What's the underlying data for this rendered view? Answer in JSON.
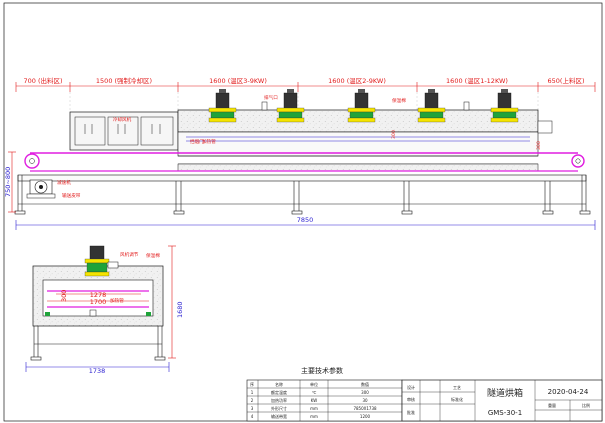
{
  "top_view": {
    "zones": [
      {
        "text": "700 (出料区)"
      },
      {
        "text": "1500 (强制冷却区)"
      },
      {
        "text": "1600 (温区3-9KW)"
      },
      {
        "text": "1600 (温区2-9KW)"
      },
      {
        "text": "1600 (温区1-12KW)"
      },
      {
        "text": "650(上料区)"
      }
    ],
    "height_label": "750~800",
    "total_length": "7850",
    "inner_height_a": "300",
    "inner_height_b": "300",
    "annotations": {
      "cooling_fan": "冷却风机",
      "exhaust_a": "排气口",
      "exhaust_b": "排气口",
      "insulation": "保温棉",
      "vent_gate": "挡烟门",
      "heating_tube": "加热管",
      "motor": "减速机",
      "belt": "输送皮带"
    }
  },
  "section_view": {
    "width_1278": "1278",
    "width_1700": "1700",
    "height_300": "300",
    "total_height": "1680",
    "total_width": "1738",
    "annotations": {
      "fan_guard": "风机调节",
      "cover": "保温棉",
      "heating_tube": "加热管"
    }
  },
  "tech_table": {
    "title": "主要技术参数",
    "header": {
      "c1": "序",
      "c2": "名称",
      "c3": "单位",
      "c4": "数值"
    },
    "rows": [
      {
        "n": "1",
        "name": "额定温度",
        "unit": "℃",
        "value": "300"
      },
      {
        "n": "2",
        "name": "加热功率",
        "unit": "KW",
        "value": "30"
      },
      {
        "n": "3",
        "name": "外形尺寸",
        "unit": "mm",
        "value": "7850X1738"
      },
      {
        "n": "4",
        "name": "输送带宽",
        "unit": "mm",
        "value": "1200"
      }
    ]
  },
  "title_block": {
    "drawing_name": "隧道烘箱",
    "model": "GMS-30-1",
    "date": "2020-04-24",
    "notes": {
      "design": "设计",
      "check": "审核",
      "approve": "批准",
      "craft": "工艺",
      "standard": "标准化",
      "weight": "重量",
      "scale": "比例"
    }
  },
  "colors": {
    "line": "#1a1a1a",
    "dimension": "#e21b1b",
    "belt": "#e01ee0",
    "box_fill": "#eeeeee",
    "motor_yellow": "#f5e400",
    "motor_green": "#1fa33a"
  }
}
